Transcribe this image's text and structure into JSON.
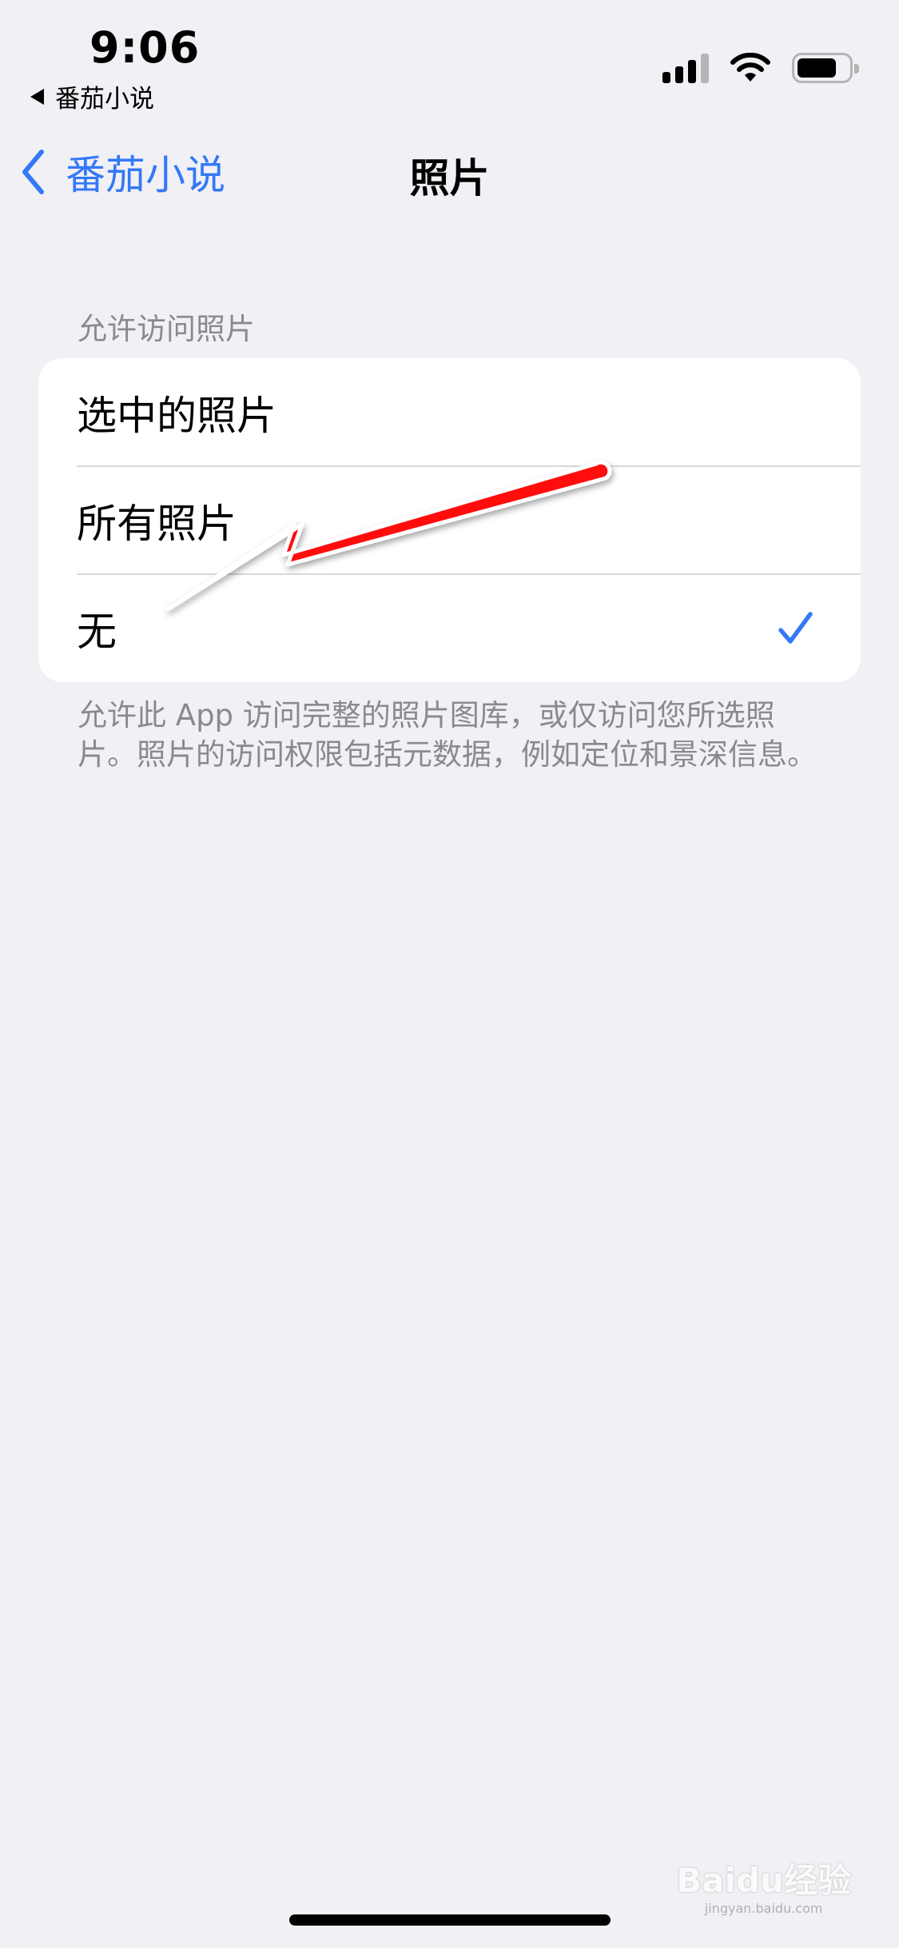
{
  "status_bar": {
    "time": "9:06",
    "back_app_label": "番茄小说",
    "signal_icon": "cellular-signal-icon",
    "wifi_icon": "wifi-icon",
    "battery_icon": "battery-icon",
    "battery_level": 0.75
  },
  "nav": {
    "back_label": "番茄小说",
    "back_icon": "chevron-left-icon",
    "title": "照片"
  },
  "section": {
    "header": "允许访问照片",
    "options": [
      {
        "label": "选中的照片",
        "selected": false
      },
      {
        "label": "所有照片",
        "selected": false
      },
      {
        "label": "无",
        "selected": true
      }
    ],
    "footer": "允许此 App 访问完整的照片图库，或仅访问您所选照片。照片的访问权限包括元数据，例如定位和景深信息。"
  },
  "annotation": {
    "type": "red-arrow",
    "points_to": "无",
    "color": "#ff0000"
  },
  "watermark": {
    "brand": "Baidu经验",
    "url": "jingyan.baidu.com"
  },
  "colors": {
    "background": "#f0f0f5",
    "accent": "#3478f6",
    "secondary_text": "#8a8a8e",
    "separator": "#d7d7dc"
  }
}
